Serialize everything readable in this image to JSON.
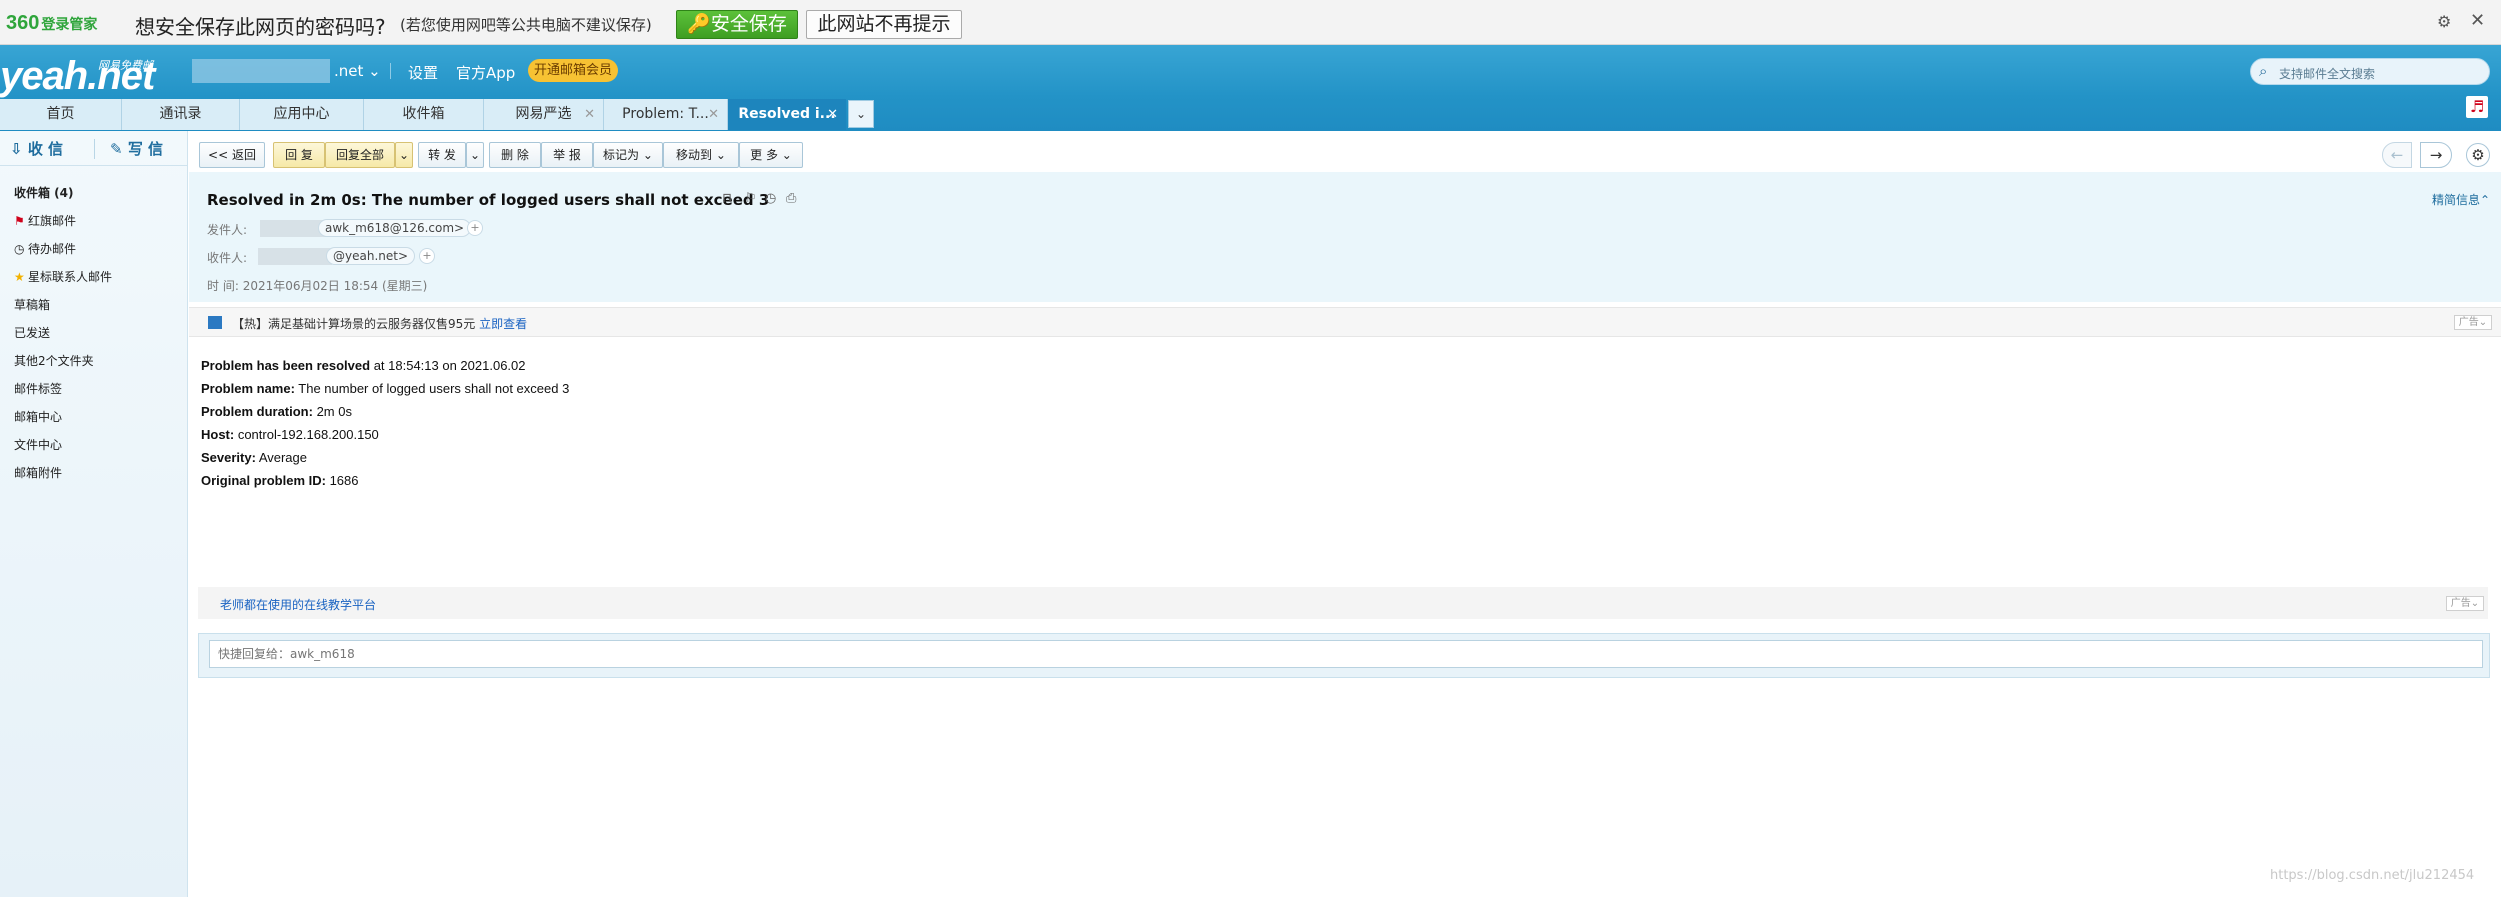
{
  "bar360": {
    "logo": "360",
    "logo_sub": "登录管家",
    "question": "想安全保存此网页的密码吗?",
    "hint": "(若您使用网吧等公共电脑不建议保存)",
    "save_label": "安全保存",
    "noask_label": "此网站不再提示",
    "gear_icon": "gear-icon",
    "close_icon": "close-icon"
  },
  "header": {
    "brand": "yeah.net",
    "brand_sub": "网易免费邮",
    "account": ".net ⌄",
    "settings": "设置",
    "app": "官方App",
    "vip": "开通邮箱会员",
    "search_placeholder": "支持邮件全文搜索"
  },
  "tabs": [
    {
      "label": "首页"
    },
    {
      "label": "通讯录"
    },
    {
      "label": "应用中心"
    },
    {
      "label": "收件箱"
    },
    {
      "label": "网易严选"
    },
    {
      "label": "Problem: T..."
    },
    {
      "label": "Resolved i..."
    }
  ],
  "sidebar": {
    "receive": "收 信",
    "write": "写 信",
    "items": [
      {
        "label": "收件箱 (4)"
      },
      {
        "label": "红旗邮件"
      },
      {
        "label": "待办邮件"
      },
      {
        "label": "星标联系人邮件"
      },
      {
        "label": "草稿箱"
      },
      {
        "label": "已发送"
      },
      {
        "label": "其他2个文件夹"
      },
      {
        "label": "邮件标签"
      },
      {
        "label": "邮箱中心"
      },
      {
        "label": "文件中心"
      },
      {
        "label": "邮箱附件"
      }
    ]
  },
  "toolbar": {
    "back": "<< 返回",
    "reply": "回 复",
    "reply_all": "回复全部",
    "forward": "转 发",
    "delete": "删 除",
    "report": "举 报",
    "mark_as": "标记为",
    "move_to": "移动到",
    "more": "更 多"
  },
  "mail": {
    "subject": "Resolved in 2m 0s: The number of logged users shall not exceed 3",
    "brief": "精简信息⌃",
    "from_label": "发件人:",
    "from_addr": "awk_m618@126.com>",
    "to_label": "收件人:",
    "to_addr": "@yeah.net>",
    "time_label": "时   间:",
    "time_value": "2021年06月02日 18:54 (星期三)"
  },
  "ad": {
    "text": "【热】满足基础计算场景的云服务器仅售95元 ",
    "link": "立即查看",
    "badge": "广告⌄"
  },
  "body": {
    "l1_b": "Problem has been resolved",
    "l1": " at 18:54:13 on 2021.06.02",
    "l2_b": "Problem name:",
    "l2": " The number of logged users shall not exceed 3",
    "l3_b": "Problem duration:",
    "l3": " 2m 0s",
    "l4_b": "Host:",
    "l4": " control-192.168.200.150",
    "l5_b": "Severity:",
    "l5": " Average",
    "l6_b": "Original problem ID:",
    "l6": " 1686"
  },
  "ad2": {
    "text": "老师都在使用的在线教学平台",
    "badge": "广告⌄"
  },
  "quick_reply_placeholder": "快捷回复给：awk_m618",
  "watermark": "https://blog.csdn.net/jlu212454"
}
